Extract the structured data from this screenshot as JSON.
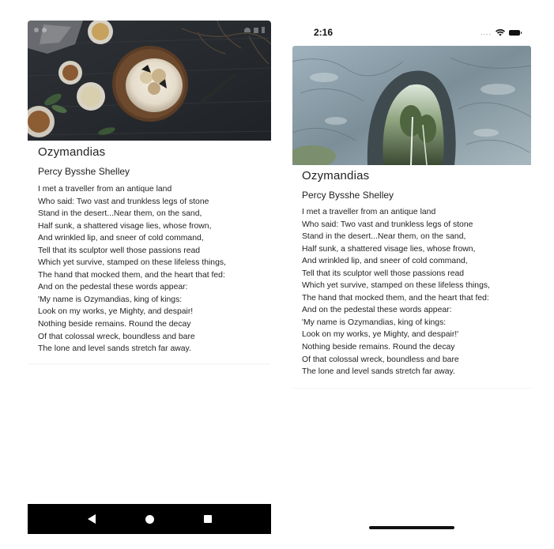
{
  "poem": {
    "title": "Ozymandias",
    "author": "Percy Bysshe Shelley",
    "lines": [
      "I met a traveller from an antique land",
      "Who said: Two vast and trunkless legs of stone",
      "Stand in the desert...Near them, on the sand,",
      "Half sunk, a shattered visage lies, whose frown,",
      "And wrinkled lip, and sneer of cold command,",
      "Tell that its sculptor well those passions read",
      "Which yet survive, stamped on these lifeless things,",
      "The hand that mocked them, and the heart that fed:",
      "And on the pedestal these words appear:",
      "'My name is Ozymandias, king of kings:",
      "Look on my works, ye Mighty, and despair!",
      "Nothing beside remains. Round the decay",
      "Of that colossal wreck, boundless and bare",
      "The lone and level sands stretch far away."
    ]
  },
  "ios_poem_line_11": "Look on my works, ye Mighty, and despair!'",
  "android": {
    "hero_image": "food-table-photo",
    "navbar": {
      "back_icon": "back-triangle-icon",
      "home_icon": "home-circle-icon",
      "recents_icon": "recents-square-icon"
    }
  },
  "ios": {
    "time": "2:16",
    "signal": "....",
    "hero_image": "stone-arch-photo"
  },
  "colors": {
    "android_navbar": "#000000",
    "text": "#222222",
    "background": "#ffffff"
  }
}
